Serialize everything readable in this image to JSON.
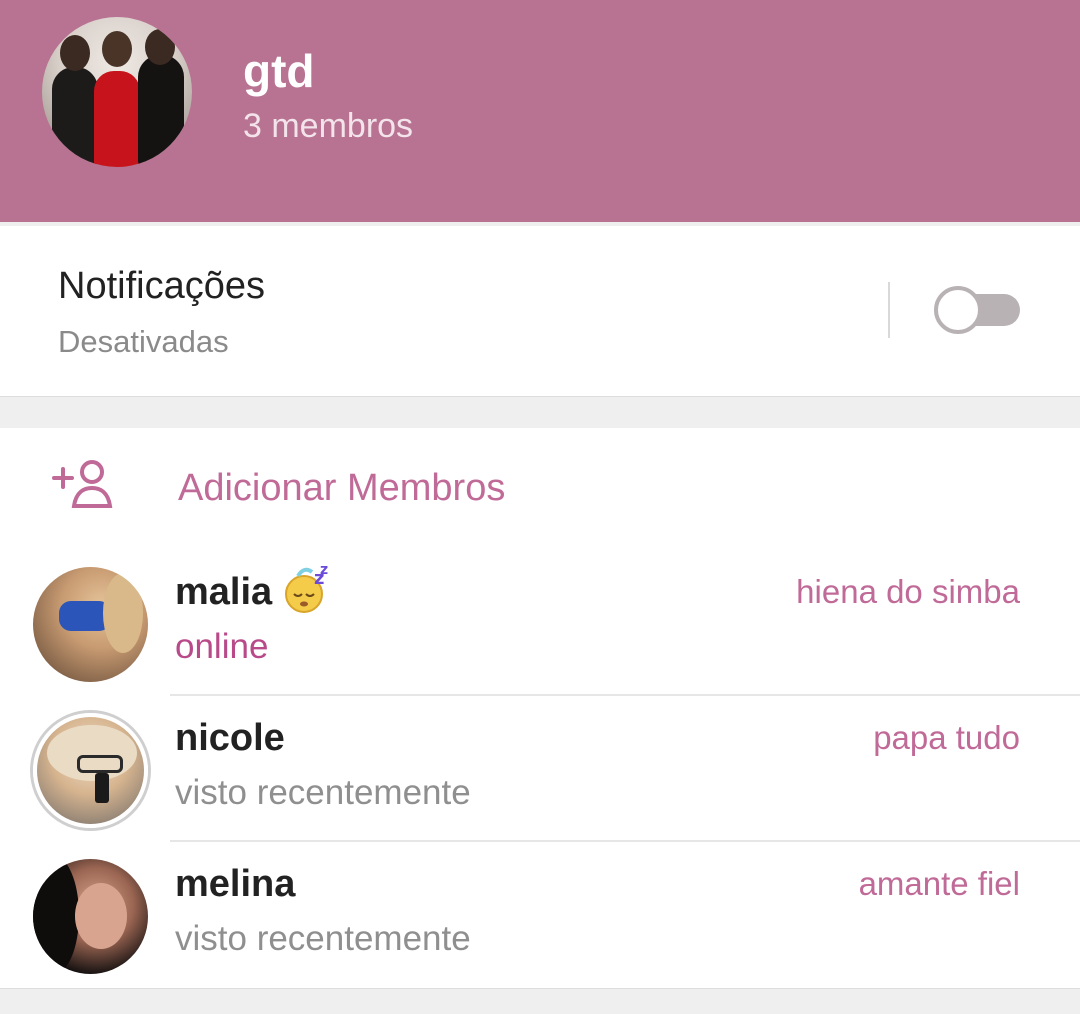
{
  "header": {
    "title": "gtd",
    "subtitle": "3 membros",
    "color": "#b87292"
  },
  "notifications": {
    "title": "Notificações",
    "status": "Desativadas",
    "enabled": false
  },
  "members_section": {
    "add_label": "Adicionar Membros",
    "add_icon": "add-person-icon",
    "accent": "#c06a98",
    "members": [
      {
        "name": "malia",
        "status": "online",
        "role": "hiena do simba",
        "emoji": "sleeping-face-emoji"
      },
      {
        "name": "nicole",
        "status": "visto recentemente",
        "role": "papa tudo"
      },
      {
        "name": "melina",
        "status": "visto recentemente",
        "role": "amante fiel"
      }
    ]
  }
}
